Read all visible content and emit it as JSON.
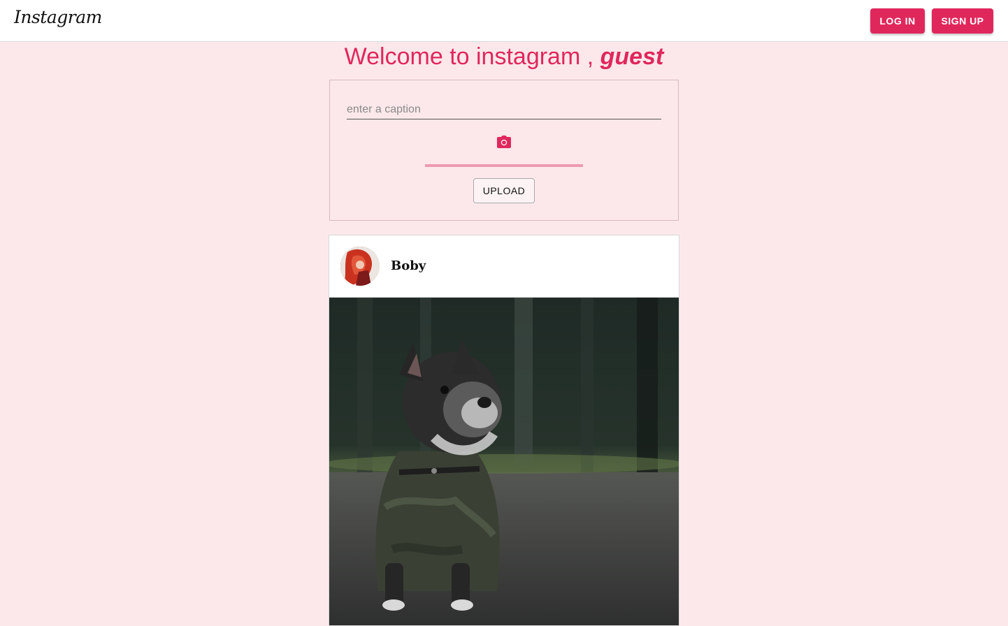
{
  "header": {
    "logo": "Instagram",
    "login_label": "LOG IN",
    "signup_label": "SIGN UP"
  },
  "welcome": {
    "prefix": "Welcome to instagram ,",
    "username": "guest"
  },
  "upload": {
    "caption_placeholder": "enter a caption",
    "caption_value": "",
    "upload_label": "UPLOAD",
    "progress": 1.0,
    "camera_icon": "camera-icon"
  },
  "post": {
    "username": "Boby",
    "avatar": "avatar-photo",
    "image": "french-bulldog-photo"
  },
  "colors": {
    "accent": "#e0275c",
    "background": "#fce8ea"
  }
}
